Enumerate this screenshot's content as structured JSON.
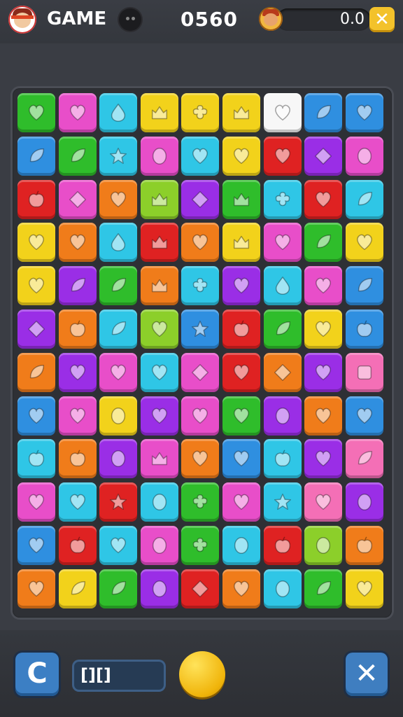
{
  "header": {
    "title": "GAME",
    "score": "0560",
    "progress_value": "0.0",
    "close_label": "✕"
  },
  "footer": {
    "restart_label": "C",
    "moves_label": "[][]"
  },
  "board": {
    "rows": 12,
    "cols": 9,
    "colors": {
      "G": "#2fbd2b",
      "M": "#e84ec9",
      "C": "#2fc6e6",
      "Y": "#f2d21b",
      "W": "#f7f7f7",
      "B": "#2f8fe0",
      "R": "#df2222",
      "P": "#9a2ee6",
      "O": "#f07c1a",
      "L": "#8ccf2a",
      "K": "#f46fb6"
    },
    "tiles": [
      [
        "G",
        "M",
        "C",
        "Y",
        "Y",
        "Y",
        "W",
        "B",
        "B"
      ],
      [
        "B",
        "G",
        "C",
        "M",
        "C",
        "Y",
        "R",
        "P",
        "M"
      ],
      [
        "R",
        "M",
        "O",
        "L",
        "P",
        "G",
        "C",
        "R",
        "C"
      ],
      [
        "Y",
        "O",
        "C",
        "R",
        "O",
        "Y",
        "M",
        "G",
        "Y"
      ],
      [
        "Y",
        "P",
        "G",
        "O",
        "C",
        "P",
        "C",
        "M",
        "B"
      ],
      [
        "P",
        "O",
        "C",
        "L",
        "B",
        "R",
        "G",
        "Y",
        "B"
      ],
      [
        "O",
        "P",
        "M",
        "C",
        "M",
        "R",
        "O",
        "P",
        "K"
      ],
      [
        "B",
        "M",
        "Y",
        "P",
        "M",
        "G",
        "P",
        "O",
        "B"
      ],
      [
        "C",
        "O",
        "P",
        "M",
        "O",
        "B",
        "C",
        "P",
        "K"
      ],
      [
        "M",
        "C",
        "R",
        "C",
        "G",
        "M",
        "C",
        "K",
        "P"
      ],
      [
        "B",
        "R",
        "C",
        "M",
        "G",
        "C",
        "R",
        "L",
        "O"
      ],
      [
        "O",
        "Y",
        "G",
        "P",
        "R",
        "O",
        "C",
        "G",
        "Y"
      ]
    ],
    "shapes": [
      [
        "heart",
        "heart",
        "drop",
        "crown",
        "clover",
        "crown",
        "heart",
        "leaf",
        "heart"
      ],
      [
        "leaf",
        "leaf",
        "star",
        "egg",
        "heart",
        "heart",
        "heart",
        "diamond",
        "egg"
      ],
      [
        "apple",
        "diamond",
        "heart",
        "crown",
        "diamond",
        "crown",
        "clover",
        "heart",
        "leaf"
      ],
      [
        "heart",
        "heart",
        "drop",
        "crown",
        "heart",
        "crown",
        "heart",
        "leaf",
        "heart"
      ],
      [
        "heart",
        "leaf",
        "leaf",
        "crown",
        "clover",
        "heart",
        "drop",
        "heart",
        "leaf"
      ],
      [
        "diamond",
        "apple",
        "leaf",
        "heart",
        "star",
        "apple",
        "leaf",
        "heart",
        "apple"
      ],
      [
        "leaf",
        "heart",
        "heart",
        "heart",
        "diamond",
        "heart",
        "diamond",
        "heart",
        "square"
      ],
      [
        "heart",
        "heart",
        "egg",
        "heart",
        "heart",
        "heart",
        "egg",
        "heart",
        "heart"
      ],
      [
        "apple",
        "apple",
        "egg",
        "crown",
        "heart",
        "heart",
        "apple",
        "heart",
        "leaf"
      ],
      [
        "heart",
        "heart",
        "star",
        "egg",
        "clover",
        "heart",
        "star",
        "heart",
        "egg"
      ],
      [
        "heart",
        "apple",
        "heart",
        "egg",
        "clover",
        "egg",
        "apple",
        "egg",
        "apple"
      ],
      [
        "heart",
        "leaf",
        "leaf",
        "egg",
        "diamond",
        "heart",
        "egg",
        "leaf",
        "heart"
      ]
    ]
  }
}
